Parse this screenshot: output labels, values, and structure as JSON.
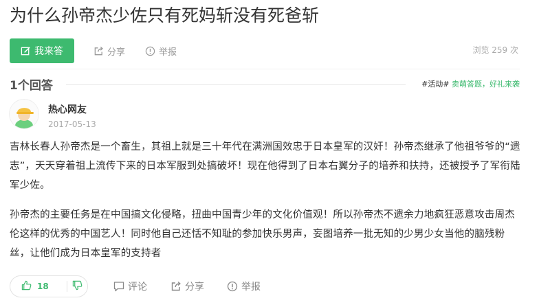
{
  "question": {
    "title": "为什么孙帝杰少佐只有死妈斩没有死爸斩"
  },
  "toolbar": {
    "answer_label": "我来答",
    "share_label": "分享",
    "report_label": "举报",
    "views_text": "浏览 259 次"
  },
  "answers_header": {
    "count_label": "1个回答",
    "activity_tag": "#活动#",
    "activity_promo": "卖萌答题，好礼来袭"
  },
  "answer": {
    "username": "热心网友",
    "date": "2017-05-13",
    "paragraphs": [
      "吉林长春人孙帝杰是一个畜生，其祖上就是三十年代在满洲国效忠于日本皇军的汉奸！孙帝杰继承了他祖爷爷的“遗志”，天天穿着祖上流传下来的日本军服到处搞破坏！现在他得到了日本右翼分子的培养和扶持，还被授予了军衔陆军少佐。",
      "孙帝杰的主要任务是在中国搞文化侵略，扭曲中国青少年的文化价值观！所以孙帝杰不遗余力地疯狂恶意攻击周杰伦这样的优秀的中国艺人！同时他自己还恬不知耻的参加快乐男声，妄图培养一批无知的少男少女当他的脑残粉丝，让他们成为日本皇军的支持者"
    ],
    "upvotes": "18",
    "comment_label": "评论",
    "share_label": "分享",
    "report_label": "举报"
  },
  "colors": {
    "accent": "#3dba6f",
    "muted": "#999999"
  }
}
